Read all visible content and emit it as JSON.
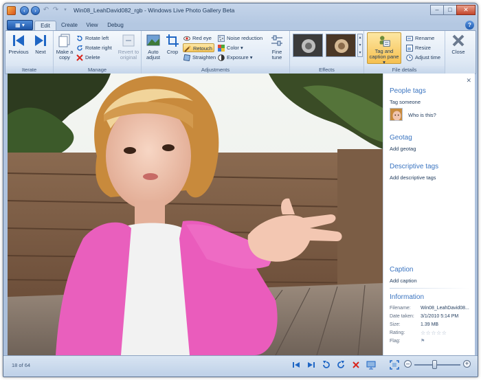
{
  "window": {
    "title": "Win08_LeahDavid082_rgb - Windows Live Photo Gallery Beta"
  },
  "tabs": [
    {
      "label": "Edit",
      "active": true
    },
    {
      "label": "Create",
      "active": false
    },
    {
      "label": "View",
      "active": false
    },
    {
      "label": "Debug",
      "active": false
    }
  ],
  "ribbon": {
    "iterate": {
      "label": "Iterate",
      "previous": "Previous",
      "next": "Next"
    },
    "manage": {
      "label": "Manage",
      "make_copy": "Make a copy",
      "rotate_left": "Rotate left",
      "rotate_right": "Rotate right",
      "delete": "Delete",
      "revert": "Revert to original"
    },
    "adjustments": {
      "label": "Adjustments",
      "auto_adjust": "Auto adjust",
      "crop": "Crop",
      "red_eye": "Red eye",
      "retouch": "Retouch",
      "straighten": "Straighten",
      "noise_reduction": "Noise reduction",
      "color": "Color",
      "exposure": "Exposure",
      "fine_tune": "Fine tune"
    },
    "effects": {
      "label": "Effects"
    },
    "file_details": {
      "label": "File details",
      "tag_caption_pane": "Tag and caption pane",
      "rename": "Rename",
      "resize": "Resize",
      "adjust_time": "Adjust time"
    },
    "close": "Close"
  },
  "pane": {
    "people_tags": {
      "heading": "People tags",
      "tag_someone": "Tag someone",
      "who_is_this": "Who is this?"
    },
    "geotag": {
      "heading": "Geotag",
      "add": "Add geotag"
    },
    "descriptive_tags": {
      "heading": "Descriptive tags",
      "add": "Add descriptive tags"
    },
    "caption": {
      "heading": "Caption",
      "add": "Add caption"
    },
    "information": {
      "heading": "Information",
      "rows": [
        {
          "label": "Filename:",
          "value": "Win08_LeahDavid08..."
        },
        {
          "label": "Date taken:",
          "value": "3/1/2010   5:14 PM"
        },
        {
          "label": "Size:",
          "value": "1.39 MB"
        },
        {
          "label": "Rating:",
          "value": ""
        },
        {
          "label": "Flag:",
          "value": ""
        }
      ],
      "rating_stars": 0
    }
  },
  "status": {
    "position": "18 of 64",
    "zoom_level": 0.45
  },
  "colors": {
    "accent_blue": "#3a74c0",
    "selected_button": "#f7c65a",
    "delete_red": "#d9251c"
  }
}
